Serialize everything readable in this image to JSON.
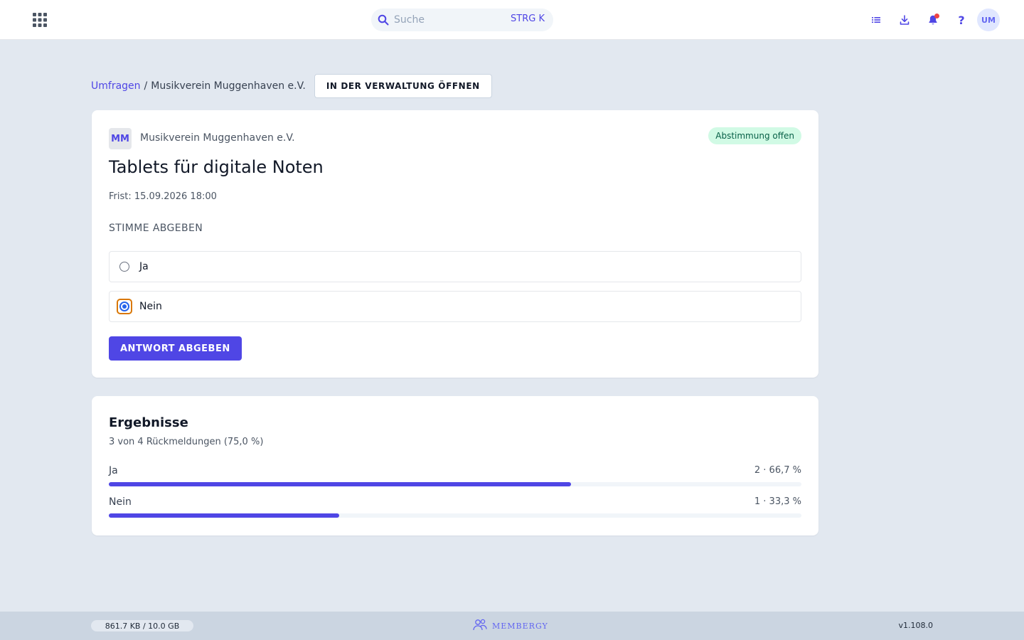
{
  "topbar": {
    "search": {
      "placeholder": "Suche",
      "shortcut": "STRG K"
    },
    "icons": [
      "apps-grid-icon",
      "list-icon",
      "download-icon",
      "bell-icon",
      "help-icon"
    ],
    "help_glyph": "?",
    "avatar_initials": "UM"
  },
  "breadcrumb": {
    "parent": "Umfragen",
    "separator": "/",
    "current": "Musikverein Muggenhaven e.V.",
    "admin_button": "IN DER VERWALTUNG ÖFFNEN"
  },
  "poll": {
    "org_initials": "MM",
    "org_name": "Musikverein Muggenhaven e.V.",
    "status": "Abstimmung offen",
    "title": "Tablets für digitale Noten",
    "deadline": "Frist: 15.09.2026 18:00",
    "vote_label": "STIMME ABGEBEN",
    "options": [
      {
        "label": "Ja",
        "selected": false
      },
      {
        "label": "Nein",
        "selected": true
      }
    ],
    "submit_label": "ANTWORT ABGEBEN"
  },
  "results": {
    "title": "Ergebnisse",
    "summary": "3 von 4 Rückmeldungen (75,0 %)",
    "items": [
      {
        "label": "Ja",
        "value": "2 · 66,7 %",
        "share": 0.667
      },
      {
        "label": "Nein",
        "value": "1 · 33,3 %",
        "share": 0.333
      }
    ]
  },
  "footer": {
    "storage": "861.7 KB / 10.0 GB",
    "brand": "MEMBERGY",
    "version": "v1.108.0"
  },
  "colors": {
    "accent": "#4f46e5",
    "status_bg": "#d1fae5",
    "status_text": "#065f46",
    "notification_dot": "#ef4444"
  }
}
